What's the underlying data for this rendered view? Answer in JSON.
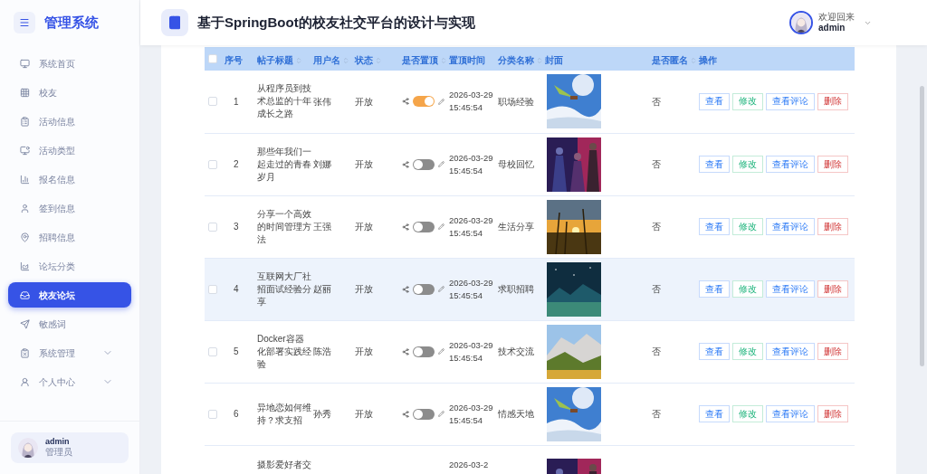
{
  "sidebar": {
    "title": "管理系统",
    "items": [
      {
        "label": "系统首页",
        "selected": false
      },
      {
        "label": "校友",
        "selected": false
      },
      {
        "label": "活动信息",
        "selected": false
      },
      {
        "label": "活动类型",
        "selected": false
      },
      {
        "label": "报名信息",
        "selected": false
      },
      {
        "label": "签到信息",
        "selected": false
      },
      {
        "label": "招聘信息",
        "selected": false
      },
      {
        "label": "论坛分类",
        "selected": false
      },
      {
        "label": "校友论坛",
        "selected": true
      },
      {
        "label": "敏感词",
        "selected": false
      },
      {
        "label": "系统管理",
        "selected": false,
        "expanded": false
      },
      {
        "label": "个人中心",
        "selected": false,
        "expanded": false
      }
    ],
    "user": {
      "name": "admin",
      "role": "管理员"
    }
  },
  "header": {
    "title": "基于SpringBoot的校友社交平台的设计与实现",
    "greeting": "欢迎回来",
    "user": "admin"
  },
  "table": {
    "select_all": {
      "checked": false
    },
    "columns": [
      {
        "label": "序号",
        "sortable": false
      },
      {
        "label": "帖子标题",
        "sortable": true
      },
      {
        "label": "用户名",
        "sortable": true
      },
      {
        "label": "状态",
        "sortable": true
      },
      {
        "label": "是否置顶",
        "sortable": true
      },
      {
        "label": "置顶时间",
        "sortable": false
      },
      {
        "label": "分类名称",
        "sortable": true
      },
      {
        "label": "封面",
        "sortable": false
      },
      {
        "label": "是否匿名",
        "sortable": true
      },
      {
        "label": "操作",
        "sortable": false
      }
    ],
    "rows": [
      {
        "checked": false,
        "highlighted": false,
        "index": "1",
        "title": "从程序员到技术总监的十年成长之路",
        "user": "张伟",
        "status": "开放",
        "pinned": true,
        "time": "2026-03-29 15:45:54",
        "category": "职场经验",
        "anonymous": "否",
        "actions": [
          "查看",
          "修改",
          "查看评论",
          "删除"
        ]
      },
      {
        "checked": false,
        "highlighted": false,
        "index": "2",
        "title": "那些年我们一起走过的青春岁月",
        "user": "刘娜",
        "status": "开放",
        "pinned": false,
        "time": "2026-03-29 15:45:54",
        "category": "母校回忆",
        "anonymous": "否",
        "actions": [
          "查看",
          "修改",
          "查看评论",
          "删除"
        ]
      },
      {
        "checked": false,
        "highlighted": false,
        "index": "3",
        "title": "分享一个高效的时间管理方法",
        "user": "王强",
        "status": "开放",
        "pinned": false,
        "time": "2026-03-29 15:45:54",
        "category": "生活分享",
        "anonymous": "否",
        "actions": [
          "查看",
          "修改",
          "查看评论",
          "删除"
        ]
      },
      {
        "checked": false,
        "highlighted": true,
        "index": "4",
        "title": "互联网大厂社招面试经验分享",
        "user": "赵丽",
        "status": "开放",
        "pinned": false,
        "time": "2026-03-29 15:45:54",
        "category": "求职招聘",
        "anonymous": "否",
        "actions": [
          "查看",
          "修改",
          "查看评论",
          "删除"
        ]
      },
      {
        "checked": false,
        "highlighted": false,
        "index": "5",
        "title": "Docker容器化部署实践经验",
        "user": "陈浩",
        "status": "开放",
        "pinned": false,
        "time": "2026-03-29 15:45:54",
        "category": "技术交流",
        "anonymous": "否",
        "actions": [
          "查看",
          "修改",
          "查看评论",
          "删除"
        ]
      },
      {
        "checked": false,
        "highlighted": false,
        "index": "6",
        "title": "异地恋如何维持？求支招",
        "user": "孙秀",
        "status": "开放",
        "pinned": false,
        "time": "2026-03-29 15:45:54",
        "category": "情感天地",
        "anonymous": "否",
        "actions": [
          "查看",
          "修改",
          "查看评论",
          "删除"
        ]
      },
      {
        "title": "摄影爱好者交",
        "time": "2026-03-2"
      }
    ]
  }
}
